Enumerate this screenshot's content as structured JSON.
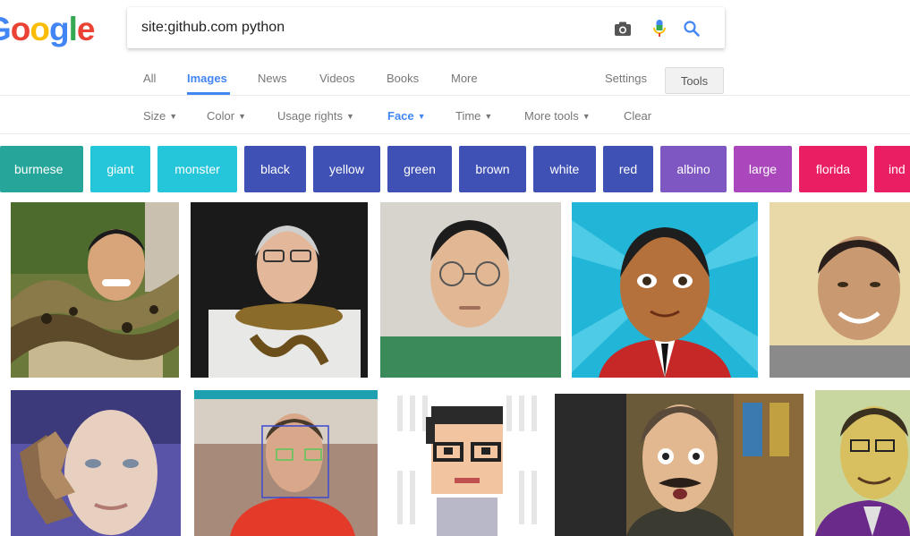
{
  "logo": {
    "letters": [
      "G",
      "o",
      "o",
      "g",
      "l",
      "e"
    ],
    "visible_text": "oogle"
  },
  "search": {
    "query": "site:github.com python",
    "icons": [
      "camera-icon",
      "microphone-icon",
      "search-icon"
    ]
  },
  "tabs": {
    "items": [
      {
        "label": "All",
        "active": false
      },
      {
        "label": "Images",
        "active": true
      },
      {
        "label": "News",
        "active": false
      },
      {
        "label": "Videos",
        "active": false
      },
      {
        "label": "Books",
        "active": false
      },
      {
        "label": "More",
        "active": false
      }
    ],
    "settings_label": "Settings",
    "tools_label": "Tools"
  },
  "filters": [
    {
      "label": "Size",
      "active": false
    },
    {
      "label": "Color",
      "active": false
    },
    {
      "label": "Usage rights",
      "active": false
    },
    {
      "label": "Face",
      "active": true
    },
    {
      "label": "Time",
      "active": false
    },
    {
      "label": "More tools",
      "active": false
    },
    {
      "label": "Clear",
      "active": false
    }
  ],
  "chips": [
    {
      "label": "burmese",
      "color": "#26a69a"
    },
    {
      "label": "giant",
      "color": "#26c6da"
    },
    {
      "label": "monster",
      "color": "#26c6da"
    },
    {
      "label": "black",
      "color": "#3f51b5"
    },
    {
      "label": "yellow",
      "color": "#3f51b5"
    },
    {
      "label": "green",
      "color": "#3f51b5"
    },
    {
      "label": "brown",
      "color": "#3f51b5"
    },
    {
      "label": "white",
      "color": "#3f51b5"
    },
    {
      "label": "red",
      "color": "#3f51b5"
    },
    {
      "label": "albino",
      "color": "#7e57c2"
    },
    {
      "label": "large",
      "color": "#ab47bc"
    },
    {
      "label": "florida",
      "color": "#e91e63"
    },
    {
      "label": "ind",
      "color": "#e91e63"
    }
  ],
  "images": {
    "row1": [
      "man-with-python-photo",
      "man-with-glasses-and-python-photo",
      "young-man-with-glasses-photo",
      "cartoon-man-avatar",
      "smiling-bald-man-photo"
    ],
    "row2": [
      "3d-face-mesh-render",
      "face-detection-screenshot",
      "pixel-art-man-with-glasses",
      "surprised-man-with-mustache-photo",
      "man-with-glasses-photo"
    ]
  },
  "colors": {
    "accent": "#4285f4",
    "text_muted": "#777777"
  }
}
